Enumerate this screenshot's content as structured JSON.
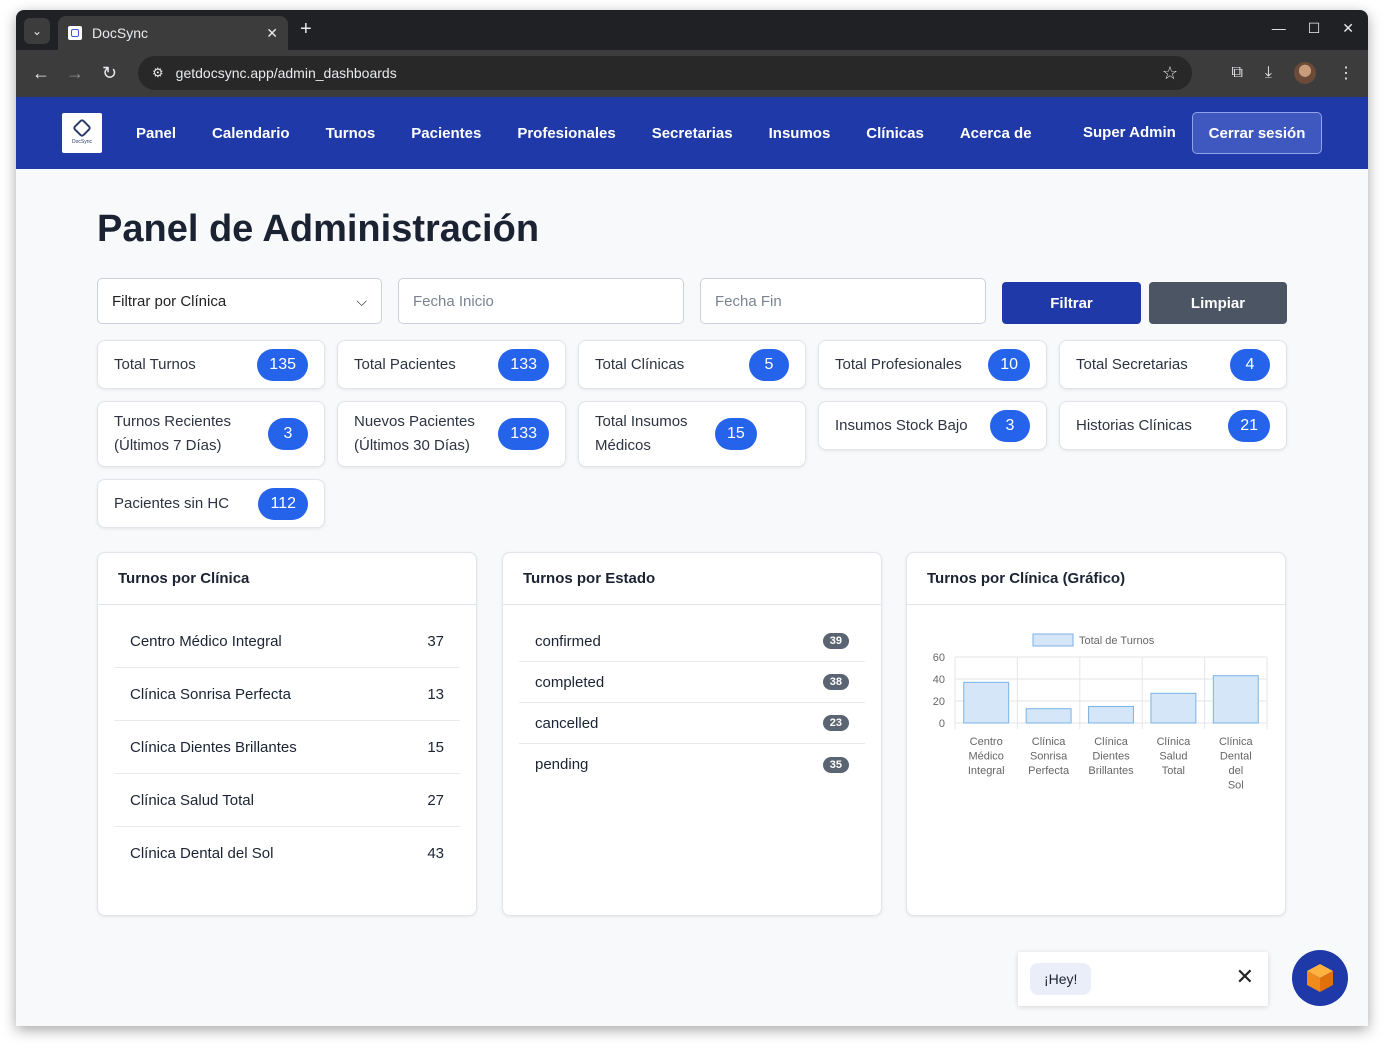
{
  "browser": {
    "tab_title": "DocSync",
    "url": "getdocsync.app/admin_dashboards"
  },
  "nav": {
    "logo_text": "DocSync",
    "links": [
      "Panel",
      "Calendario",
      "Turnos",
      "Pacientes",
      "Profesionales",
      "Secretarias",
      "Insumos",
      "Clínicas",
      "Acerca de"
    ],
    "user": "Super Admin",
    "logout": "Cerrar sesión"
  },
  "page": {
    "title": "Panel de Administración"
  },
  "filters": {
    "clinic_select": "Filtrar por Clínica",
    "start_placeholder": "Fecha Inicio",
    "end_placeholder": "Fecha Fin",
    "filter_button": "Filtrar",
    "clear_button": "Limpiar"
  },
  "stats": [
    {
      "label": "Total Turnos",
      "value": "135"
    },
    {
      "label": "Total Pacientes",
      "value": "133"
    },
    {
      "label": "Total Clínicas",
      "value": "5"
    },
    {
      "label": "Total Profesionales",
      "value": "10"
    },
    {
      "label": "Total Secretarias",
      "value": "4"
    },
    {
      "label": "Turnos Recientes (Últimos 7 Días)",
      "value": "3"
    },
    {
      "label": "Nuevos Pacientes (Últimos 30 Días)",
      "value": "133"
    },
    {
      "label": "Total Insumos Médicos",
      "value": "15"
    },
    {
      "label": "Insumos Stock Bajo",
      "value": "3"
    },
    {
      "label": "Historias Clínicas",
      "value": "21"
    },
    {
      "label": "Pacientes sin HC",
      "value": "112"
    }
  ],
  "turnos_por_clinica": {
    "title": "Turnos por Clínica",
    "rows": [
      {
        "name": "Centro Médico Integral",
        "value": "37"
      },
      {
        "name": "Clínica Sonrisa Perfecta",
        "value": "13"
      },
      {
        "name": "Clínica Dientes Brillantes",
        "value": "15"
      },
      {
        "name": "Clínica Salud Total",
        "value": "27"
      },
      {
        "name": "Clínica Dental del Sol",
        "value": "43"
      }
    ]
  },
  "turnos_por_estado": {
    "title": "Turnos por Estado",
    "rows": [
      {
        "name": "confirmed",
        "value": "39"
      },
      {
        "name": "completed",
        "value": "38"
      },
      {
        "name": "cancelled",
        "value": "23"
      },
      {
        "name": "pending",
        "value": "35"
      }
    ]
  },
  "chart_card_title": "Turnos por Clínica (Gráfico)",
  "chart_data": {
    "type": "bar",
    "title": "",
    "categories": [
      [
        "Centro",
        "Médico",
        "Integral"
      ],
      [
        "Clínica",
        "Sonrisa",
        "Perfecta"
      ],
      [
        "Clínica",
        "Dientes",
        "Brillantes"
      ],
      [
        "Clínica",
        "Salud",
        "Total"
      ],
      [
        "Clínica",
        "Dental",
        "del",
        "Sol"
      ]
    ],
    "series": [
      {
        "name": "Total de Turnos",
        "values": [
          37,
          13,
          15,
          27,
          43
        ]
      }
    ],
    "yticks": [
      0,
      20,
      40,
      60
    ],
    "ylim": [
      0,
      60
    ],
    "grid": true,
    "legend": "top",
    "colors": {
      "fill": "#d4e6f7",
      "stroke": "#7bb3e6"
    }
  },
  "chat": {
    "greeting": "¡Hey!"
  },
  "colors": {
    "nav_bg": "#1f3aa8",
    "primary": "#2563eb",
    "filter_btn": "#1f3aa8",
    "clear_btn": "#4b5563"
  }
}
